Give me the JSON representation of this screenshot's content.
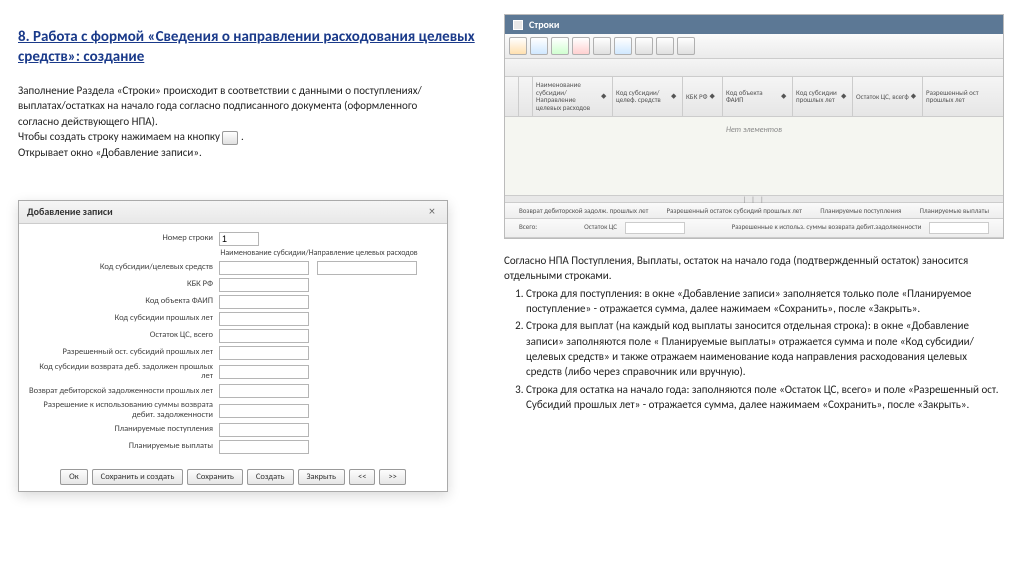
{
  "title": "8. Работа с формой «Сведения о направлении расходования целевых средств»: создание",
  "intro1": "Заполнение Раздела «Строки» происходит в соответствии с данными о поступлениях/выплатах/остатках на начало года согласно подписанного документа (оформленного согласно действующего НПА).",
  "intro2a": "Чтобы создать строку нажимаем на кнопку ",
  "intro2b": " .",
  "intro3": "Открывает окно «Добавление записи».",
  "dialog": {
    "title": "Добавление записи",
    "fields": [
      "Номер строки",
      "",
      "Код субсидии/целевых средств",
      "КБК РФ",
      "Код объекта ФАИП",
      "Код субсидии прошлых лет",
      "Остаток ЦС, всего",
      "Разрешенный ост. субсидий прошлых лет",
      "Код субсидии возврата деб. задолжен прошлых лет",
      "Возврат дебиторской задолженности прошлых лет",
      "Разрешение к использованию суммы возврата дебит. задолженности",
      "Планируемые поступления",
      "Планируемые выплаты"
    ],
    "subsidy_name_label": "Наименование субсидии/Направление целевых расходов",
    "row_num_value": "1",
    "buttons": [
      "Ок",
      "Сохранить и создать",
      "Сохранить",
      "Создать",
      "Закрыть",
      "<<",
      ">>"
    ]
  },
  "panel": {
    "title": "Строки",
    "columns": [
      "Наименование субсидии/Направление целевых расходов",
      "Код субсидии/целеф. средств",
      "КБК РФ",
      "Код объекта ФАИП",
      "Код субсидии прошлых лет",
      "Остаток ЦС, всегф",
      "Разрешенный ост прошлых лет"
    ],
    "empty": "Нет элементов",
    "summary_top": [
      "Возврат дебиторской задолж. прошлых лет",
      "Разрешенный остаток субсидий прошлых лет",
      "Планируемые поступления",
      "Планируемые выплаты"
    ],
    "total_label": "Всего:",
    "summary_bottom_a": "Остаток ЦС",
    "summary_bottom_b": "Разрешенные к использ. суммы возврата дебит.задолженности"
  },
  "right_intro": "Согласно НПА Поступления, Выплаты, остаток на начало года (подтвержденный остаток) заносится отдельными строками.",
  "items": [
    "Строка для поступления: в окне «Добавление записи» заполняется только поле «Планируемое поступление» - отражается сумма, далее нажимаем «Сохранить», после «Закрыть».",
    "Строка для выплат (на каждый код выплаты заносится отдельная строка): в окне «Добавление записи» заполняются поле « Планируемые выплаты» отражается сумма и поле «Код субсидии/целевых средств» и также отражаем наименование кода направления расходования целевых средств (либо через справочник или вручную).",
    "Строка для остатка на начало года: заполняются поле «Остаток ЦС, всего» и поле «Разрешенный ост. Субсидий прошлых лет» - отражается сумма, далее нажимаем «Сохранить», после «Закрыть»."
  ]
}
